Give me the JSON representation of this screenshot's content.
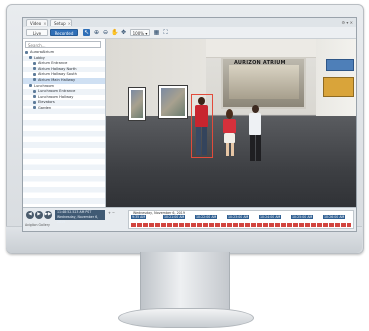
{
  "tabs": [
    {
      "label": "Video"
    },
    {
      "label": "Setup"
    }
  ],
  "window_controls": "⚙ ▾ ✕",
  "toolbar": {
    "buttons": [
      {
        "label": "Live"
      },
      {
        "label": "Recorded"
      }
    ],
    "zoom_label": "100% ▾"
  },
  "sidebar": {
    "search_placeholder": "Search...",
    "items": [
      {
        "label": "AuroraAtrium"
      },
      {
        "label": "Lobby"
      },
      {
        "label": "Atrium Entrance"
      },
      {
        "label": "Atrium Hallway North"
      },
      {
        "label": "Atrium Hallway South"
      },
      {
        "label": "Atrium Main Hallway"
      },
      {
        "label": "Lunchroom"
      },
      {
        "label": "Lunchroom Entrance"
      },
      {
        "label": "Lunchroom Hallway"
      },
      {
        "label": "Elevators"
      },
      {
        "label": "Garden"
      }
    ]
  },
  "video": {
    "wall_sign": "AURIZON ATRIUM"
  },
  "timeline": {
    "time_line1": "11:48:52.523 AM PST",
    "time_line2": "Wednesday, November 6, 2019",
    "date_label": "Wednesday, November 6, 2019",
    "ticks": [
      "9:35 AM",
      "10:21:00 AM",
      "10:22:00 AM",
      "10:23:00 AM",
      "10:24:00 AM",
      "10:25:00 AM",
      "10:26:00 AM"
    ],
    "status": "Avigilon Gallery",
    "zoom_label": "+  −"
  },
  "colors": {
    "accent": "#2f6fb7",
    "recording": "#d2453f",
    "detection_box": "#e24b3b"
  }
}
